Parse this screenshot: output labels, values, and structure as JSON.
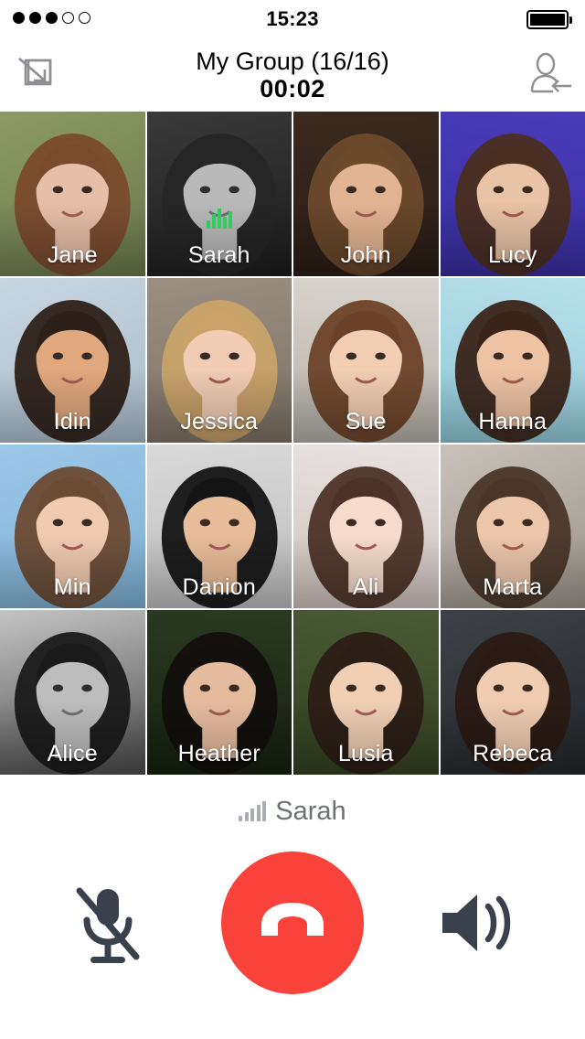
{
  "status_bar": {
    "signal_label": "signal-strength",
    "signal_total": 5,
    "signal_filled": 3,
    "time": "15:23",
    "battery_label": "battery-full",
    "battery_level": 100
  },
  "header": {
    "minimize_icon": "minimize-icon",
    "title": "My Group (16/16)",
    "timer": "00:02",
    "add_participant_icon": "add-participant-icon"
  },
  "colors": {
    "end_call_red": "#f9423a",
    "speaking_green": "#2fcc61",
    "control_dark": "#3b414c",
    "muted_gray": "#6e7277"
  },
  "grid": {
    "rows": 4,
    "columns": 4,
    "participants": [
      {
        "name": "Jane",
        "speaking": false,
        "bg_top": "#8d9968",
        "bg_bottom": "#6b7a4c",
        "skin": "#e6bfa8",
        "hair": "#7a4a2e",
        "mono": false
      },
      {
        "name": "Sarah",
        "speaking": true,
        "bg_top": "#3a3a3a",
        "bg_bottom": "#1c1c1c",
        "skin": "#b9b9b9",
        "hair": "#262626",
        "mono": true
      },
      {
        "name": "John",
        "speaking": false,
        "bg_top": "#3a2a20",
        "bg_bottom": "#2a1d16",
        "skin": "#e3b494",
        "hair": "#6b4a2c",
        "mono": false
      },
      {
        "name": "Lucy",
        "speaking": false,
        "bg_top": "#4a3bb8",
        "bg_bottom": "#3a2ea0",
        "skin": "#e8c3a5",
        "hair": "#4a2e20",
        "mono": false
      },
      {
        "name": "Idin",
        "speaking": false,
        "bg_top": "#c8d6e0",
        "bg_bottom": "#a9bccb",
        "skin": "#e0a87e",
        "hair": "#2d2019",
        "mono": false
      },
      {
        "name": "Jessica",
        "speaking": false,
        "bg_top": "#9b8f82",
        "bg_bottom": "#7d7265",
        "skin": "#f0cdb4",
        "hair": "#c9a36a",
        "mono": false
      },
      {
        "name": "Sue",
        "speaking": false,
        "bg_top": "#d8d4cd",
        "bg_bottom": "#b5b0a8",
        "skin": "#f2cfb3",
        "hair": "#6b4228",
        "mono": false
      },
      {
        "name": "Hanna",
        "speaking": false,
        "bg_top": "#b9e0ea",
        "bg_bottom": "#8fc9d8",
        "skin": "#eec3a4",
        "hair": "#3a2419",
        "mono": false
      },
      {
        "name": "Min",
        "speaking": false,
        "bg_top": "#9cc8e8",
        "bg_bottom": "#7fb0d4",
        "skin": "#f0cbb0",
        "hair": "#6b4b34",
        "mono": false
      },
      {
        "name": "Danion",
        "speaking": false,
        "bg_top": "#d9d9d9",
        "bg_bottom": "#bdbdbd",
        "skin": "#e8bd99",
        "hair": "#141414",
        "mono": false
      },
      {
        "name": "Ali",
        "speaking": false,
        "bg_top": "#e8e2e0",
        "bg_bottom": "#cfc3c0",
        "skin": "#f7dccb",
        "hair": "#4d3327",
        "mono": false
      },
      {
        "name": "Marta",
        "speaking": false,
        "bg_top": "#c9c2ba",
        "bg_bottom": "#9b948c",
        "skin": "#ecc6ab",
        "hair": "#4a3628",
        "mono": false
      },
      {
        "name": "Alice",
        "speaking": false,
        "bg_top": "#c4c4c4",
        "bg_bottom": "#4a4a4a",
        "skin": "#bdbdbd",
        "hair": "#1a1a1a",
        "mono": true
      },
      {
        "name": "Heather",
        "speaking": false,
        "bg_top": "#2a3a22",
        "bg_bottom": "#16200f",
        "skin": "#e5bb9e",
        "hair": "#120f0d",
        "mono": false
      },
      {
        "name": "Lusia",
        "speaking": false,
        "bg_top": "#4a5a36",
        "bg_bottom": "#33401f",
        "skin": "#f0cfb4",
        "hair": "#2b1e16",
        "mono": false
      },
      {
        "name": "Rebeca",
        "speaking": false,
        "bg_top": "#3f4348",
        "bg_bottom": "#23262a",
        "skin": "#f0cdb2",
        "hair": "#2a1a14",
        "mono": false
      }
    ]
  },
  "footer": {
    "active_speaker_icon": "audio-level-icon",
    "active_speaker_name": "Sarah",
    "mute_icon": "microphone-muted-icon",
    "mute_label": "Mute",
    "end_call_icon": "hang-up-icon",
    "end_call_label": "End call",
    "speaker_icon": "speaker-on-icon",
    "speaker_label": "Speaker"
  }
}
